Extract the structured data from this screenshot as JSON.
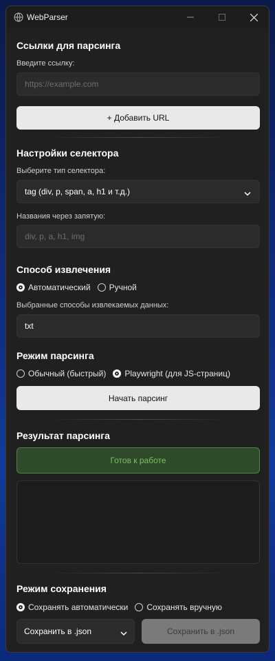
{
  "window": {
    "title": "WebParser"
  },
  "links": {
    "section_title": "Ссылки для парсинга",
    "url_label": "Введите ссылку:",
    "url_placeholder": "https://example.com",
    "add_button": "+ Добавить URL"
  },
  "selector": {
    "section_title": "Настройки селектора",
    "type_label": "Выберите тип селектора:",
    "type_value": "tag (div, p, span, a, h1 и т.д.)",
    "names_label": "Названия через запятую:",
    "names_placeholder": "div, p, a, h1, img"
  },
  "extraction": {
    "section_title": "Способ извлечения",
    "options": [
      {
        "label": "Автоматический",
        "selected": true
      },
      {
        "label": "Ручной",
        "selected": false
      }
    ],
    "chosen_label": "Выбранные способы извлекаемых данных:",
    "chosen_value": "txt"
  },
  "parsing_mode": {
    "section_title": "Режим парсинга",
    "options": [
      {
        "label": "Обычный (быстрый)",
        "selected": false
      },
      {
        "label": "Playwright (для JS-страниц)",
        "selected": true
      }
    ],
    "start_button": "Начать парсинг"
  },
  "result": {
    "section_title": "Результат парсинга",
    "status": "Готов к работе",
    "output": ""
  },
  "save_mode": {
    "section_title": "Режим сохранения",
    "options": [
      {
        "label": "Сохранять автоматически",
        "selected": true
      },
      {
        "label": "Сохранять вручную",
        "selected": false
      }
    ],
    "format_value": "Сохранить в .json",
    "save_button": "Сохранить в .json"
  },
  "colors": {
    "window_bg": "#202020",
    "field_bg": "#2b2b2b",
    "status_bg": "#2e4a2a",
    "status_text": "#7fbf5f"
  }
}
